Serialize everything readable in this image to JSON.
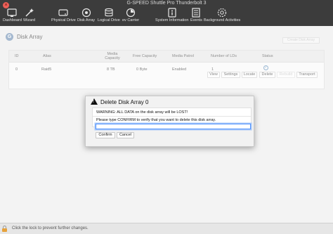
{
  "window": {
    "title": "G-SPEED Shuttle Pro Thunderbolt 3",
    "close_glyph": "×"
  },
  "toolbar": {
    "items": [
      {
        "label": "Dashboard",
        "icon": "dashboard-icon"
      },
      {
        "label": "Wizard",
        "icon": "wand-icon"
      },
      {
        "label": "Physical Drive",
        "icon": "drive-icon"
      },
      {
        "label": "Disk Array",
        "icon": "disk-array-icon"
      },
      {
        "label": "Logical Drive",
        "icon": "logical-drive-icon"
      },
      {
        "label": "ev Carrier",
        "icon": "carrier-icon"
      },
      {
        "label": "System Information",
        "icon": "info-icon"
      },
      {
        "label": "Events",
        "icon": "events-icon"
      },
      {
        "label": "Background Activities",
        "icon": "activity-icon"
      }
    ]
  },
  "page": {
    "icon_letter": "G",
    "title": "Disk Array",
    "create_button": "Create Disk Array"
  },
  "table": {
    "headers": {
      "id": "ID",
      "alias": "Alias",
      "capacity": "Media Capacity",
      "free": "Free Capacity",
      "patrol": "Media Patrol",
      "lds": "Number of LDs",
      "status": "Status"
    },
    "rows": [
      {
        "id": "0",
        "alias": "Raid5",
        "capacity": "8 TB",
        "free": "0 Byte",
        "patrol": "Enabled",
        "lds": "1",
        "status_icon": "check-circle-icon"
      }
    ],
    "row_buttons": {
      "view": "View",
      "settings": "Settings",
      "locate": "Locate",
      "delete": "Delete",
      "rebuild": "Rebuild",
      "transport": "Transport"
    }
  },
  "dialog": {
    "icon": "warning-icon",
    "title": "Delete Disk Array 0",
    "warning": "WARNING: ALL DATA on the disk array will be LOST!",
    "prompt": "Please type CONFIRM to verify that you want to delete this disk array.",
    "input_value": "",
    "confirm_label": "Confirm",
    "cancel_label": "Cancel"
  },
  "footer": {
    "text": "Click the lock to prevent further changes."
  },
  "colors": {
    "accent": "#4d90fe",
    "toolbar": "#3c3c3c",
    "lock": "#e6a23c"
  }
}
